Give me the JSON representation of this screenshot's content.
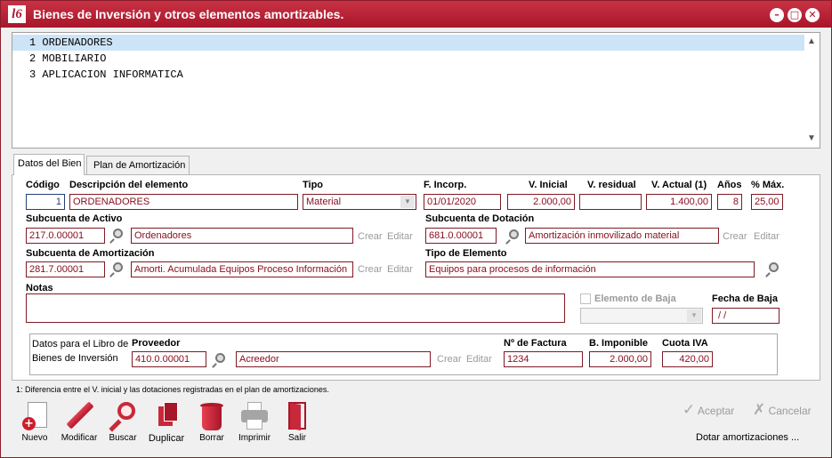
{
  "window": {
    "title": "Bienes de Inversión y otros elementos amortizables.",
    "logo": "l6"
  },
  "list": [
    "1 ORDENADORES",
    "2 MOBILIARIO",
    "3 APLICACION INFORMATICA"
  ],
  "tabs": [
    "Datos del Bien",
    "Plan de Amortización"
  ],
  "form": {
    "codigo_label": "Código",
    "codigo": "1",
    "descripcion_label": "Descripción del elemento",
    "descripcion": "ORDENADORES",
    "tipo_label": "Tipo",
    "tipo": "Material",
    "fincorp_label": "F. Incorp.",
    "fincorp": "01/01/2020",
    "vinicial_label": "V. Inicial",
    "vinicial": "2.000,00",
    "vresidual_label": "V. residual",
    "vresidual": "",
    "vactual_label": "V. Actual (1)",
    "vactual": "1.400,00",
    "anos_label": "Años",
    "anos": "8",
    "pmax_label": "% Máx.",
    "pmax": "25,00",
    "sub_activo_label": "Subcuenta de Activo",
    "sub_activo": "217.0.00001",
    "sub_activo_desc": "Ordenadores",
    "sub_dotacion_label": "Subcuenta de Dotación",
    "sub_dotacion": "681.0.00001",
    "sub_dotacion_desc": "Amortización inmovilizado material",
    "sub_amort_label": "Subcuenta de Amortización",
    "sub_amort": "281.7.00001",
    "sub_amort_desc": "Amorti. Acumulada Equipos Proceso Información",
    "tipo_elem_label": "Tipo de Elemento",
    "tipo_elem": "Equipos para procesos de información",
    "crear": "Crear",
    "editar": "Editar",
    "notas_label": "Notas",
    "baja_label": "Elemento de Baja",
    "fecha_baja_label": "Fecha de Baja",
    "fecha_baja": " / /",
    "libro_label1": "Datos para el Libro de",
    "libro_label2": "Bienes de Inversión",
    "proveedor_label": "Proveedor",
    "proveedor": "410.0.00001",
    "proveedor_desc": "Acreedor",
    "factura_label": "Nº de Factura",
    "factura": "1234",
    "bimponible_label": "B. Imponible",
    "bimponible": "2.000,00",
    "cuota_label": "Cuota IVA",
    "cuota": "420,00"
  },
  "footnote": "1: Diferencia entre el V. inicial y las dotaciones registradas en el plan de amortizaciones.",
  "toolbar": {
    "nuevo": "Nuevo",
    "modificar": "Modificar",
    "buscar": "Buscar",
    "duplicar": "Duplicar",
    "borrar": "Borrar",
    "imprimir": "Imprimir",
    "salir": "Salir"
  },
  "actions": {
    "aceptar": "Aceptar",
    "cancelar": "Cancelar",
    "dotar": "Dotar amortizaciones ..."
  },
  "colors": {
    "titlebar": "#b01c30",
    "field_border": "#7f1a24",
    "field_text": "#8a1020",
    "selection": "#cde4f7"
  }
}
